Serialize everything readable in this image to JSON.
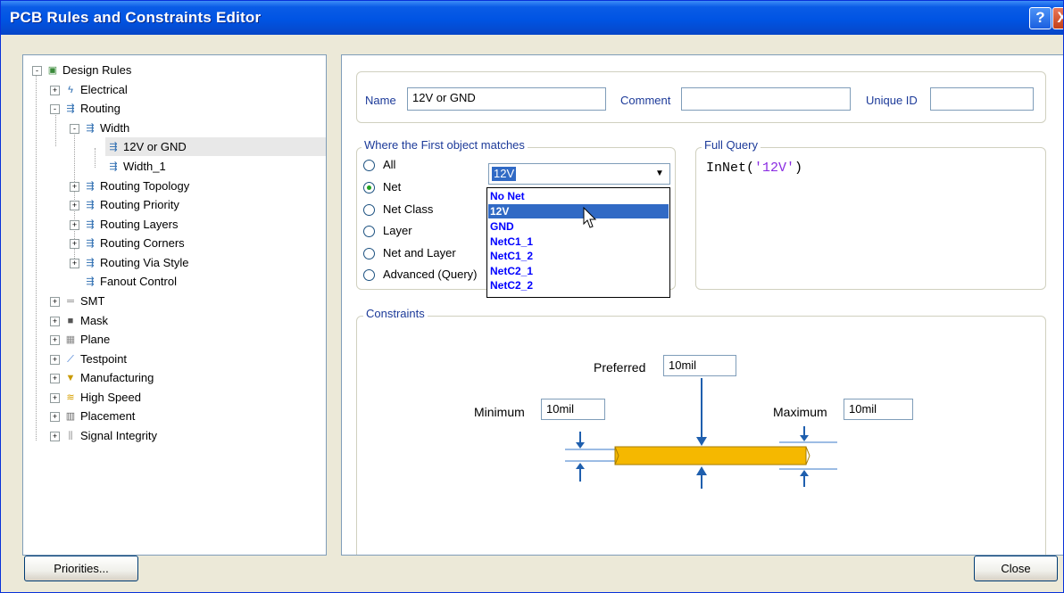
{
  "window": {
    "title": "PCB Rules and Constraints Editor",
    "help_label": "?",
    "close_label": "X"
  },
  "tree": {
    "items": [
      {
        "label": "Design Rules",
        "icon": "design-rules-icon",
        "expander": "-"
      },
      {
        "label": "Electrical",
        "icon": "electrical-icon",
        "expander": "+"
      },
      {
        "label": "Routing",
        "icon": "routing-icon",
        "expander": "-"
      },
      {
        "label": "Width",
        "icon": "width-rule-icon",
        "expander": "-"
      },
      {
        "label": "12V or GND",
        "icon": "rule-icon",
        "expander": ""
      },
      {
        "label": "Width_1",
        "icon": "rule-icon",
        "expander": ""
      },
      {
        "label": "Routing Topology",
        "icon": "routing-icon",
        "expander": "+"
      },
      {
        "label": "Routing Priority",
        "icon": "routing-icon",
        "expander": "+"
      },
      {
        "label": "Routing Layers",
        "icon": "routing-icon",
        "expander": "+"
      },
      {
        "label": "Routing Corners",
        "icon": "routing-icon",
        "expander": "+"
      },
      {
        "label": "Routing Via Style",
        "icon": "routing-icon",
        "expander": "+"
      },
      {
        "label": "Fanout Control",
        "icon": "routing-icon",
        "expander": ""
      },
      {
        "label": "SMT",
        "icon": "smt-icon",
        "expander": "+"
      },
      {
        "label": "Mask",
        "icon": "mask-icon",
        "expander": "+"
      },
      {
        "label": "Plane",
        "icon": "plane-icon",
        "expander": "+"
      },
      {
        "label": "Testpoint",
        "icon": "testpoint-icon",
        "expander": "+"
      },
      {
        "label": "Manufacturing",
        "icon": "manufacturing-icon",
        "expander": "+"
      },
      {
        "label": "High Speed",
        "icon": "high-speed-icon",
        "expander": "+"
      },
      {
        "label": "Placement",
        "icon": "placement-icon",
        "expander": "+"
      },
      {
        "label": "Signal Integrity",
        "icon": "signal-integrity-icon",
        "expander": "+"
      }
    ]
  },
  "rule": {
    "name_label": "Name",
    "name_value": "12V or GND",
    "comment_label": "Comment",
    "comment_value": "",
    "unique_id_label": "Unique ID",
    "unique_id_value": ""
  },
  "match": {
    "group_label": "Where the First object matches",
    "options": [
      "All",
      "Net",
      "Net Class",
      "Layer",
      "Net and Layer",
      "Advanced (Query)"
    ],
    "selected": "Net",
    "combo_value": "12V",
    "dropdown_items": [
      "No Net",
      "12V",
      "GND",
      "NetC1_1",
      "NetC1_2",
      "NetC2_1",
      "NetC2_2"
    ],
    "dropdown_selected": "12V"
  },
  "query": {
    "group_label": "Full Query",
    "func": "InNet(",
    "arg": "'12V'",
    "close": ")"
  },
  "constraints": {
    "group_label": "Constraints",
    "preferred_label": "Preferred",
    "preferred_value": "10mil",
    "minimum_label": "Minimum",
    "minimum_value": "10mil",
    "maximum_label": "Maximum",
    "maximum_value": "10mil",
    "track_color": "#f5b800"
  },
  "footer": {
    "priorities_label": "Priorities...",
    "close_label": "Close"
  }
}
